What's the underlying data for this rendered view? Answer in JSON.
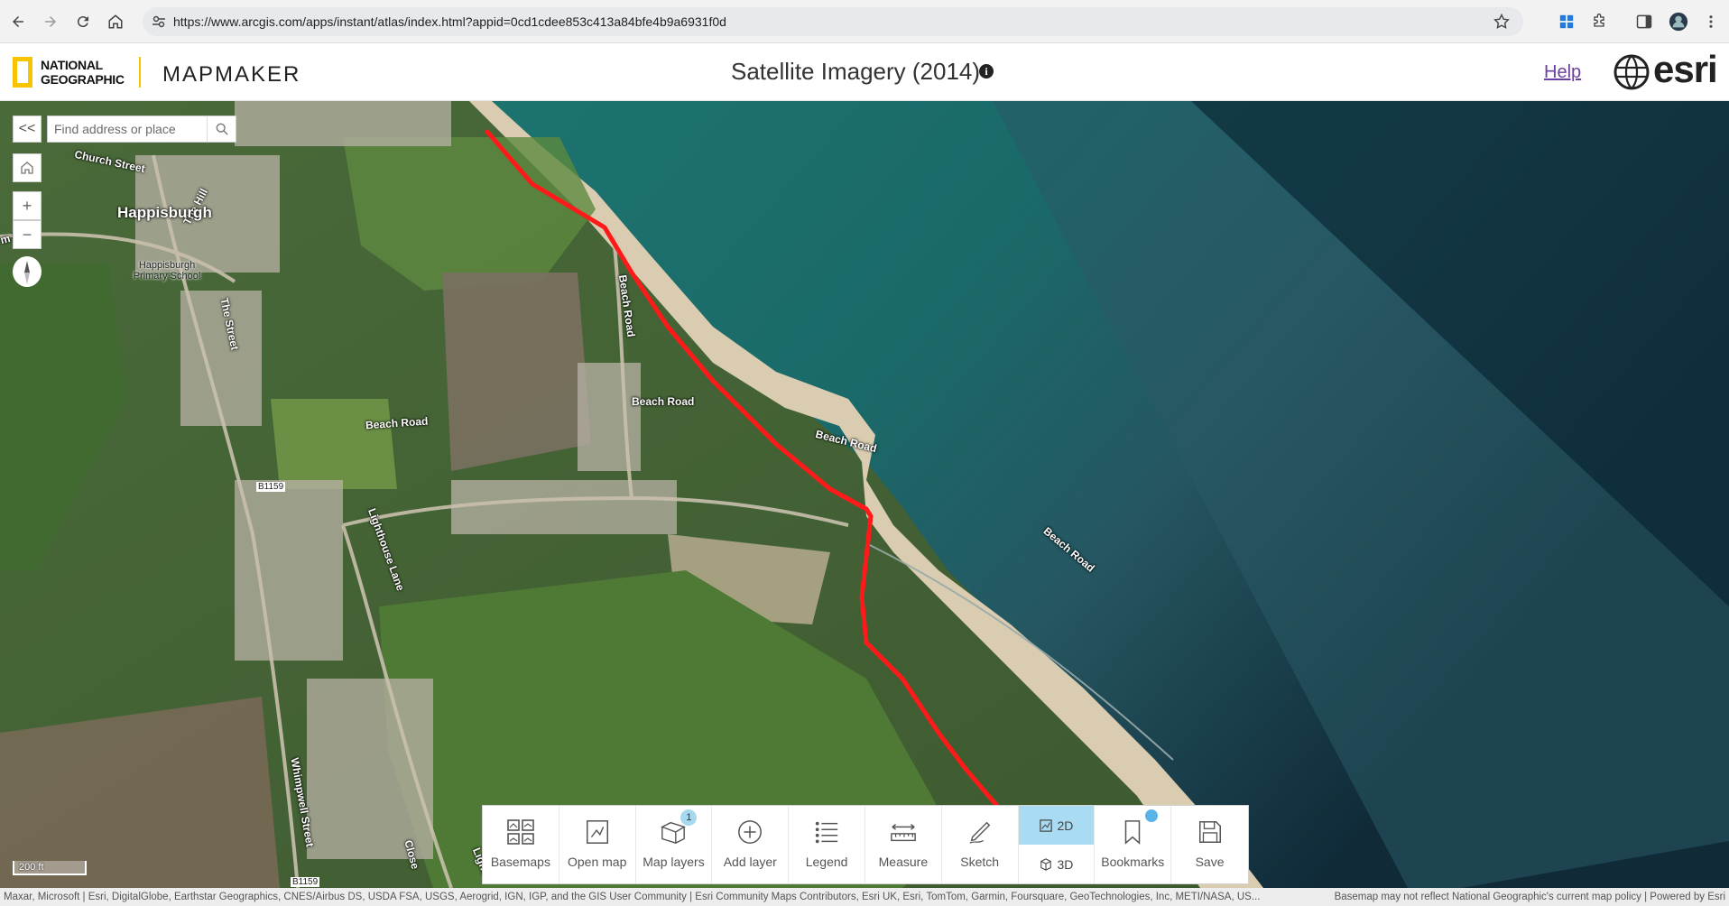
{
  "browser": {
    "url": "https://www.arcgis.com/apps/instant/atlas/index.html?appid=0cd1cdee853c413a84bfe4b9a6931f0d"
  },
  "header": {
    "brand_line1": "NATIONAL",
    "brand_line2": "GEOGRAPHIC",
    "app_name": "MAPMAKER",
    "title": "Satellite Imagery (2014)",
    "info_glyph": "i",
    "help_label": "Help",
    "esri_label": "esri"
  },
  "search": {
    "collapse_glyph": "<<",
    "placeholder": "Find address or place"
  },
  "map_controls": {
    "zoom_in": "+",
    "zoom_out": "−"
  },
  "map_labels": {
    "church_street": "Church Street",
    "the_hill": "The Hill",
    "happisburgh": "Happisburgh",
    "m_road": "m Road",
    "school": "Happisburgh Primary School",
    "beach_road_v": "Beach Road",
    "the_street": "The Street",
    "beach_road_1": "Beach Road",
    "beach_road_2": "Beach Road",
    "beach_road_3": "Beach Road",
    "beach_road_sea": "Beach Road",
    "b1159_a": "B1159",
    "b1159_b": "B1159",
    "lighthouse_lane": "Lighthouse Lane",
    "whimpwell_street": "Whimpwell Street",
    "close": "Close",
    "lighth": "Lighth"
  },
  "scale": "200 ft",
  "toolbar": {
    "items": [
      {
        "label": "Basemaps",
        "icon": "basemap-grid-icon"
      },
      {
        "label": "Open map",
        "icon": "open-map-icon"
      },
      {
        "label": "Map layers",
        "icon": "layers-icon",
        "badge": "1"
      },
      {
        "label": "Add layer",
        "icon": "plus-circle-icon"
      },
      {
        "label": "Legend",
        "icon": "list-icon"
      },
      {
        "label": "Measure",
        "icon": "ruler-icon"
      },
      {
        "label": "Sketch",
        "icon": "pen-icon"
      }
    ],
    "view_2d": "2D",
    "view_3d": "3D",
    "bookmarks": "Bookmarks",
    "save": "Save"
  },
  "attribution": {
    "left": "Maxar, Microsoft | Esri, DigitalGlobe, Earthstar Geographics, CNES/Airbus DS, USDA FSA, USGS, Aerogrid, IGN, IGP, and the GIS User Community | Esri Community Maps Contributors, Esri UK, Esri, TomTom, Garmin, Foursquare, GeoTechnologies, Inc, METI/NASA, US...",
    "right": "Basemap may not reflect National Geographic's current map policy | Powered by Esri"
  },
  "colors": {
    "accent_yellow": "#f6c500",
    "route_red": "#ff1a1a",
    "sea_teal": "#1c6e6e",
    "active_blue": "#a9dcf2",
    "help_purple": "#6b3fa0"
  }
}
